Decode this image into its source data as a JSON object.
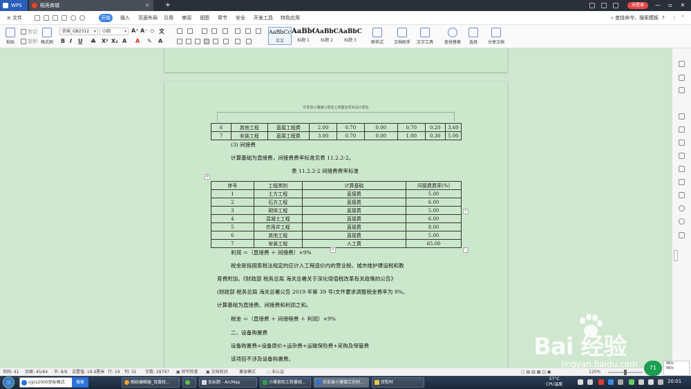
{
  "titlebar": {
    "tabs": [
      {
        "label": "WPS"
      },
      {
        "label": "稻壳商城"
      }
    ],
    "new_tab": "+",
    "login": "未登录"
  },
  "menubar": {
    "file": "文件",
    "items": [
      "开始",
      "插入",
      "页面布局",
      "引用",
      "审阅",
      "视图",
      "章节",
      "安全",
      "开发工具",
      "特色应用"
    ],
    "active": "开始",
    "search": "查找命令、搜索模板",
    "help": "?"
  },
  "ribbon": {
    "paste": "粘贴",
    "cut": "剪切",
    "copy": "复制",
    "format_painter": "格式刷",
    "font_name": "仿宋_GB2312",
    "font_size": "小四",
    "styles": [
      {
        "preview": "AaBbCcDd",
        "label": "正文"
      },
      {
        "preview": "AaBbC",
        "label": "标题 1"
      },
      {
        "preview": "AaBbCcI",
        "label": "标题 2"
      },
      {
        "preview": "AaBbCc",
        "label": "标题 3"
      }
    ],
    "new_style": "新样式",
    "doc_assistant": "文档助手",
    "text_tools": "文字工具",
    "find_replace": "查找替换",
    "select": "选择",
    "share": "分享文档"
  },
  "document": {
    "running_header": "乐安县小雅镇小雷前土地整治项目设计报告",
    "table_top_rows": [
      [
        "6",
        "其他工程",
        "直接工程费",
        "2.00",
        "0.70",
        "0.00",
        "0.70",
        "0.20",
        "3.60"
      ],
      [
        "7",
        "安装工程",
        "直接工程费",
        "3.00",
        "0.70",
        "0.00",
        "1.00",
        "0.30",
        "5.00"
      ]
    ],
    "p_indirect_heading": "(3) 间接费",
    "p_indirect_basis": "计算基础为直接费，间接费费率标准见表 11.2.2-2。",
    "table_caption": "表 11.2.2-2      间接费费率标准",
    "rate_table": {
      "headers": [
        "序号",
        "工程类别",
        "计算基础",
        "间接费费率(%)"
      ],
      "rows": [
        [
          "1",
          "土方工程",
          "直接费",
          "5.00"
        ],
        [
          "2",
          "石方工程",
          "直接费",
          "6.00"
        ],
        [
          "3",
          "砌体工程",
          "直接费",
          "5.00"
        ],
        [
          "4",
          "混凝土工程",
          "直接费",
          "6.00"
        ],
        [
          "5",
          "农用井工程",
          "直接费",
          "8.00"
        ],
        [
          "6",
          "其他工程",
          "直接费",
          "5.00"
        ],
        [
          "7",
          "安装工程",
          "人工费",
          "65.00"
        ]
      ]
    },
    "p_profit": "利润 ＝（直接费 ＋ 间接费）×9%",
    "p_tax_1": "税金是指国家税法规定的应计入工程造价内的营业税、城市维护建设税和教",
    "p_tax_2": "育费附加。《财政部 税务总局 海关总署关于深化增值税改革有关政策的公告》",
    "p_tax_3": "(财政部 税务总局 海关总署公告 2019 年第 39 号)文件要求调整税金费率为 9%。",
    "p_tax_4": "计算基础为直接费、间接费和利润之和。",
    "p_tax_formula": "税金 ＝（直接费 ＋ 间接程费 ＋ 利润）×9%",
    "p_equip_heading": "二、设备购置费",
    "p_equip_formula": "设备购置费=设备原价+运杂费+运输保险费+采购及保管费",
    "p_equip_note": "该项目不涉及设备购置费。"
  },
  "statusbar": {
    "page": "页码: 41",
    "pages": "页面: 45/64",
    "section": "节: 8/9",
    "position": "设置值: 18.9厘米",
    "row": "行: 19",
    "col": "列: 32",
    "words": "字数: 28797",
    "spell": "拼写检查",
    "proofread": "文档校对",
    "compat": "兼容模式",
    "auth": "未认证",
    "zoom": "120%"
  },
  "net_widget": {
    "badge": "71",
    "up": "0K/s",
    "down": "0K/s"
  },
  "taskbar": {
    "search_value": "cgcs2000坐标格式",
    "search_button": "搜索",
    "tasks": [
      "图经编辑器_百度经...",
      "无标题 - ArcMap",
      "小雅营前工程量统...",
      "乐安县小雅镇工农村...",
      "贸犁村"
    ],
    "temp": "57°C",
    "cpu": "CPU温度",
    "time": "20:01"
  },
  "watermark": {
    "text": "Bai 经验",
    "url": "jingyan.baidu.com"
  }
}
